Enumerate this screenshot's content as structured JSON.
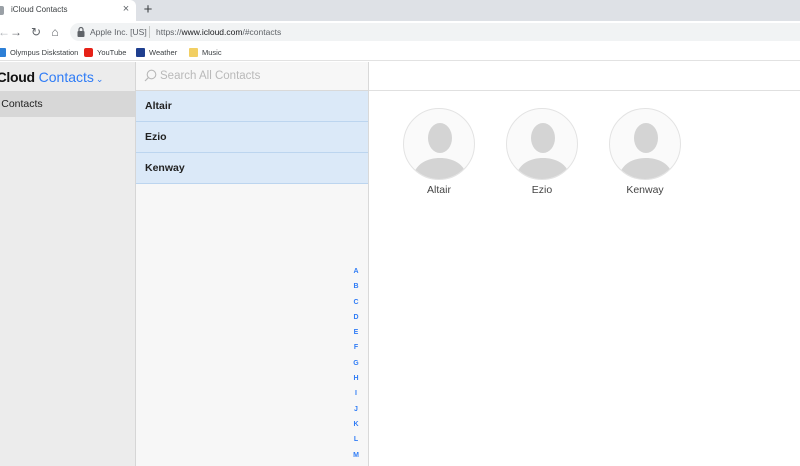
{
  "browser": {
    "tab": {
      "title": "iCloud Contacts",
      "close_glyph": "×"
    },
    "new_tab_glyph": "+",
    "nav": {
      "back": "←",
      "forward": "→",
      "reload": "↻",
      "home": "⌂"
    },
    "address": {
      "site_label": "Apple Inc. [US]",
      "url_prefix": "https://",
      "url_host": "www.icloud.com",
      "url_path": "/#contacts"
    },
    "bookmarks": [
      {
        "label": "Olympus Diskstation",
        "icon": "diskstation-icon",
        "color": "#2d7fd6"
      },
      {
        "label": "YouTube",
        "icon": "youtube-icon",
        "color": "#e62117"
      },
      {
        "label": "Weather",
        "icon": "weather-icon",
        "color": "#1f3f8f"
      },
      {
        "label": "Music",
        "icon": "folder-icon",
        "color": "#f2cf63"
      }
    ]
  },
  "app": {
    "brand": "iCloud",
    "app_name": "Contacts",
    "chevron": "⌄",
    "sidebar": {
      "group_label": "l Contacts"
    },
    "search": {
      "placeholder": "Search All Contacts",
      "value": ""
    },
    "contacts": [
      {
        "name": "Altair"
      },
      {
        "name": "Ezio"
      },
      {
        "name": "Kenway"
      }
    ],
    "alphabet": [
      "A",
      "B",
      "C",
      "D",
      "E",
      "F",
      "G",
      "H",
      "I",
      "J",
      "K",
      "L",
      "M"
    ],
    "cards": [
      {
        "name": "Altair"
      },
      {
        "name": "Ezio"
      },
      {
        "name": "Kenway"
      }
    ],
    "accent_color": "#2f7cf6",
    "selection_color": "#dbe9f8"
  }
}
